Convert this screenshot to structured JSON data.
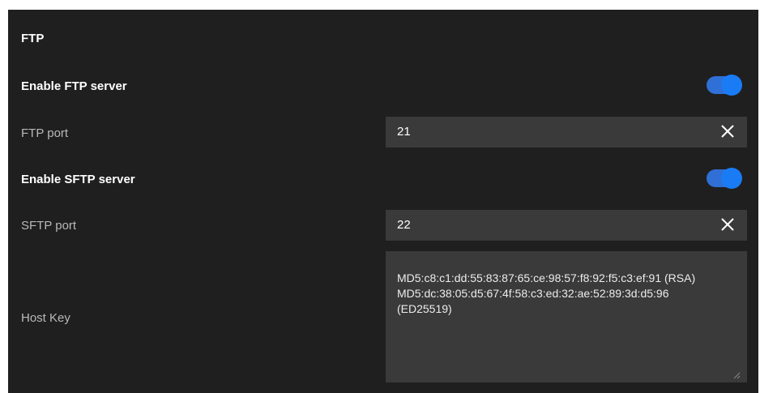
{
  "section": {
    "title": "FTP"
  },
  "ftp": {
    "enable_label": "Enable FTP server",
    "enabled": true,
    "port_label": "FTP port",
    "port_value": "21"
  },
  "sftp": {
    "enable_label": "Enable SFTP server",
    "enabled": true,
    "port_label": "SFTP port",
    "port_value": "22"
  },
  "host_key": {
    "label": "Host Key",
    "lines": [
      "MD5:c8:c1:dd:55:83:87:65:ce:98:57:f8:92:f5:c3:ef:91 (RSA)",
      "MD5:dc:38:05:d5:67:4f:58:c3:ed:32:ae:52:89:3d:d5:96",
      "(ED25519)"
    ]
  },
  "icons": {
    "clear": "close-icon",
    "resize": "resize-grip-icon"
  },
  "colors": {
    "panel_background": "#1f1f1f",
    "input_background": "#3a3a3a",
    "toggle_accent": "#1a7cf5"
  }
}
